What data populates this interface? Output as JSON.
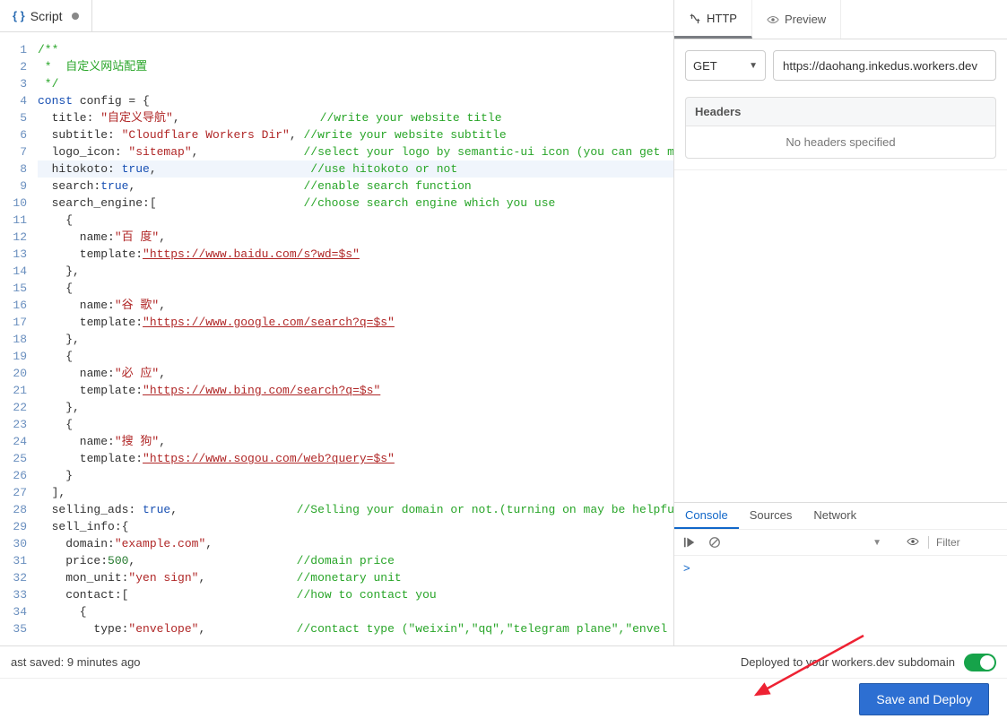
{
  "editor": {
    "tab": {
      "label": "Script",
      "modified": true
    },
    "lines": [
      [
        {
          "cls": "c-comment",
          "t": "/**"
        }
      ],
      [
        {
          "cls": "c-comment",
          "t": " *  自定义网站配置"
        }
      ],
      [
        {
          "cls": "c-comment",
          "t": " */"
        }
      ],
      [
        {
          "cls": "c-kw",
          "t": "const"
        },
        {
          "t": " config = {"
        }
      ],
      [
        {
          "t": "  title: "
        },
        {
          "cls": "c-str",
          "t": "\"自定义导航\""
        },
        {
          "t": ","
        },
        {
          "pad": 20
        },
        {
          "cls": "c-comment",
          "t": "//write your website title"
        }
      ],
      [
        {
          "t": "  subtitle: "
        },
        {
          "cls": "c-str",
          "t": "\"Cloudflare Workers Dir\""
        },
        {
          "t": ", "
        },
        {
          "cls": "c-comment",
          "t": "//write your website subtitle"
        }
      ],
      [
        {
          "t": "  logo_icon: "
        },
        {
          "cls": "c-str",
          "t": "\"sitemap\""
        },
        {
          "t": ","
        },
        {
          "pad": 15
        },
        {
          "cls": "c-comment",
          "t": "//select your logo by semantic-ui icon (you can get mo"
        }
      ],
      [
        {
          "hl": true,
          "t": "  hitokoto: "
        },
        {
          "cls": "c-bool",
          "t": "true"
        },
        {
          "t": ","
        },
        {
          "pad": 22
        },
        {
          "cls": "c-comment",
          "t": "//use hitokoto or not"
        }
      ],
      [
        {
          "t": "  search:"
        },
        {
          "cls": "c-bool",
          "t": "true"
        },
        {
          "t": ","
        },
        {
          "pad": 24
        },
        {
          "cls": "c-comment",
          "t": "//enable search function"
        }
      ],
      [
        {
          "t": "  search_engine:[ "
        },
        {
          "pad": 20
        },
        {
          "cls": "c-comment",
          "t": "//choose search engine which you use"
        }
      ],
      [
        {
          "t": "    {"
        }
      ],
      [
        {
          "t": "      name:"
        },
        {
          "cls": "c-str",
          "t": "\"百 度\""
        },
        {
          "t": ","
        }
      ],
      [
        {
          "t": "      template:"
        },
        {
          "cls": "c-link",
          "t": "\"https://www.baidu.com/s?wd=$s\""
        }
      ],
      [
        {
          "t": "    },"
        }
      ],
      [
        {
          "t": "    {"
        }
      ],
      [
        {
          "t": "      name:"
        },
        {
          "cls": "c-str",
          "t": "\"谷 歌\""
        },
        {
          "t": ","
        }
      ],
      [
        {
          "t": "      template:"
        },
        {
          "cls": "c-link",
          "t": "\"https://www.google.com/search?q=$s\""
        }
      ],
      [
        {
          "t": "    },"
        }
      ],
      [
        {
          "t": "    {"
        }
      ],
      [
        {
          "t": "      name:"
        },
        {
          "cls": "c-str",
          "t": "\"必 应\""
        },
        {
          "t": ","
        }
      ],
      [
        {
          "t": "      template:"
        },
        {
          "cls": "c-link",
          "t": "\"https://www.bing.com/search?q=$s\""
        }
      ],
      [
        {
          "t": "    },"
        }
      ],
      [
        {
          "t": "    {"
        }
      ],
      [
        {
          "t": "      name:"
        },
        {
          "cls": "c-str",
          "t": "\"搜 狗\""
        },
        {
          "t": ","
        }
      ],
      [
        {
          "t": "      template:"
        },
        {
          "cls": "c-link",
          "t": "\"https://www.sogou.com/web?query=$s\""
        }
      ],
      [
        {
          "t": "    }"
        }
      ],
      [
        {
          "t": "  ],"
        }
      ],
      [
        {
          "t": "  selling_ads: "
        },
        {
          "cls": "c-bool",
          "t": "true"
        },
        {
          "t": ","
        },
        {
          "pad": 17
        },
        {
          "cls": "c-comment",
          "t": "//Selling your domain or not.(turning on may be helpfu"
        }
      ],
      [
        {
          "t": "  sell_info:{"
        }
      ],
      [
        {
          "t": "    domain:"
        },
        {
          "cls": "c-str",
          "t": "\"example.com\""
        },
        {
          "t": ","
        }
      ],
      [
        {
          "t": "    price:"
        },
        {
          "cls": "c-num",
          "t": "500"
        },
        {
          "t": ","
        },
        {
          "pad": 23
        },
        {
          "cls": "c-comment",
          "t": "//domain price"
        }
      ],
      [
        {
          "t": "    mon_unit:"
        },
        {
          "cls": "c-str",
          "t": "\"yen sign\""
        },
        {
          "t": ","
        },
        {
          "pad": 13
        },
        {
          "cls": "c-comment",
          "t": "//monetary unit"
        }
      ],
      [
        {
          "t": "    contact:[ "
        },
        {
          "pad": 23
        },
        {
          "cls": "c-comment",
          "t": "//how to contact you"
        }
      ],
      [
        {
          "t": "      {"
        }
      ],
      [
        {
          "t": "        type:"
        },
        {
          "cls": "c-str",
          "t": "\"envelope\""
        },
        {
          "t": ","
        },
        {
          "pad": 13
        },
        {
          "cls": "c-comment",
          "t": "//contact type (\"weixin\",\"qq\",\"telegram plane\",\"envel"
        }
      ]
    ]
  },
  "right": {
    "tabs": {
      "http": "HTTP",
      "preview": "Preview"
    },
    "method": "GET",
    "url": "https://daohang.inkedus.workers.dev",
    "headers_title": "Headers",
    "headers_empty": "No headers specified",
    "devtabs": {
      "console": "Console",
      "sources": "Sources",
      "network": "Network"
    },
    "filter_placeholder": "Filter",
    "console_prompt": ">"
  },
  "status": {
    "last_saved": "ast saved: 9 minutes ago",
    "deploy_text": "Deployed to your workers.dev subdomain"
  },
  "buttons": {
    "save_deploy": "Save and Deploy"
  }
}
